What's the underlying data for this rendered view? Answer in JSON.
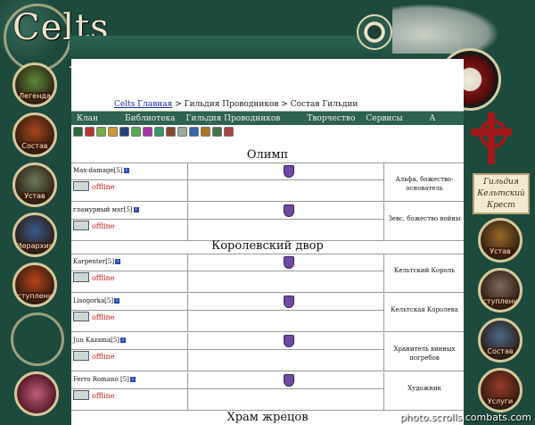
{
  "logo": "Celts",
  "guild_badge": {
    "line1": "Гильдия",
    "line2": "Кельтский",
    "line3": "Крест"
  },
  "left_menu": [
    {
      "label": "Легенда",
      "color": "#5b8a3a"
    },
    {
      "label": "Состав",
      "color": "#a8451c"
    },
    {
      "label": "Устав",
      "color": "#6b7a5a"
    },
    {
      "label": "Иерархия",
      "color": "#3a5a8a"
    },
    {
      "label": "Вступление",
      "color": "#b8421a"
    }
  ],
  "right_menu": [
    {
      "label": "Устав",
      "color": "#9a6a2a"
    },
    {
      "label": "Вступление",
      "color": "#7a6a5a"
    },
    {
      "label": "Состав",
      "color": "#4a6a8a"
    },
    {
      "label": "Услуги",
      "color": "#9a3a2a"
    }
  ],
  "breadcrumb": {
    "home": "Celts Главная",
    "sep1": " > ",
    "guild": "Гильдия Проводников",
    "sep2": " > ",
    "current": "Состав Гильдии"
  },
  "nav": {
    "items": [
      "Клан",
      "Библиотека",
      "Гильдия Проводников",
      "Творчество",
      "Сервисы",
      "A"
    ]
  },
  "icon_colors": [
    "#2a6a3a",
    "#b33",
    "#7a4",
    "#c93",
    "#247",
    "#5a5",
    "#a3a",
    "#396",
    "#843",
    "#9a9",
    "#36a",
    "#a72",
    "#474",
    "#a44"
  ],
  "sections": [
    {
      "title": "Олимп"
    },
    {
      "title": "Королевский двор"
    },
    {
      "title": "Храм жрецов"
    }
  ],
  "members": [
    {
      "name": "Max-damage",
      "level": "[5]",
      "status": "offline",
      "role": "Альфа, божество-основатель"
    },
    {
      "name": "гламурный маг",
      "level": "[5]",
      "status": "offline",
      "role": "Зевс, божество войны"
    },
    {
      "name": "Karpenter",
      "level": "[5]",
      "status": "offline",
      "role": "Кельтский Король"
    },
    {
      "name": "Lisogorka",
      "level": "[5]",
      "status": "offline",
      "role": "Кельтская Королева"
    },
    {
      "name": "Jun Kazama",
      "level": "[5]",
      "status": "offline",
      "role": "Хранитель винных погребов"
    },
    {
      "name": "Ferro Romano ",
      "level": "[5]",
      "status": "offline",
      "role": "Художник"
    }
  ],
  "info_glyph": "i",
  "watermark": "photo.scrolls.combats.com"
}
